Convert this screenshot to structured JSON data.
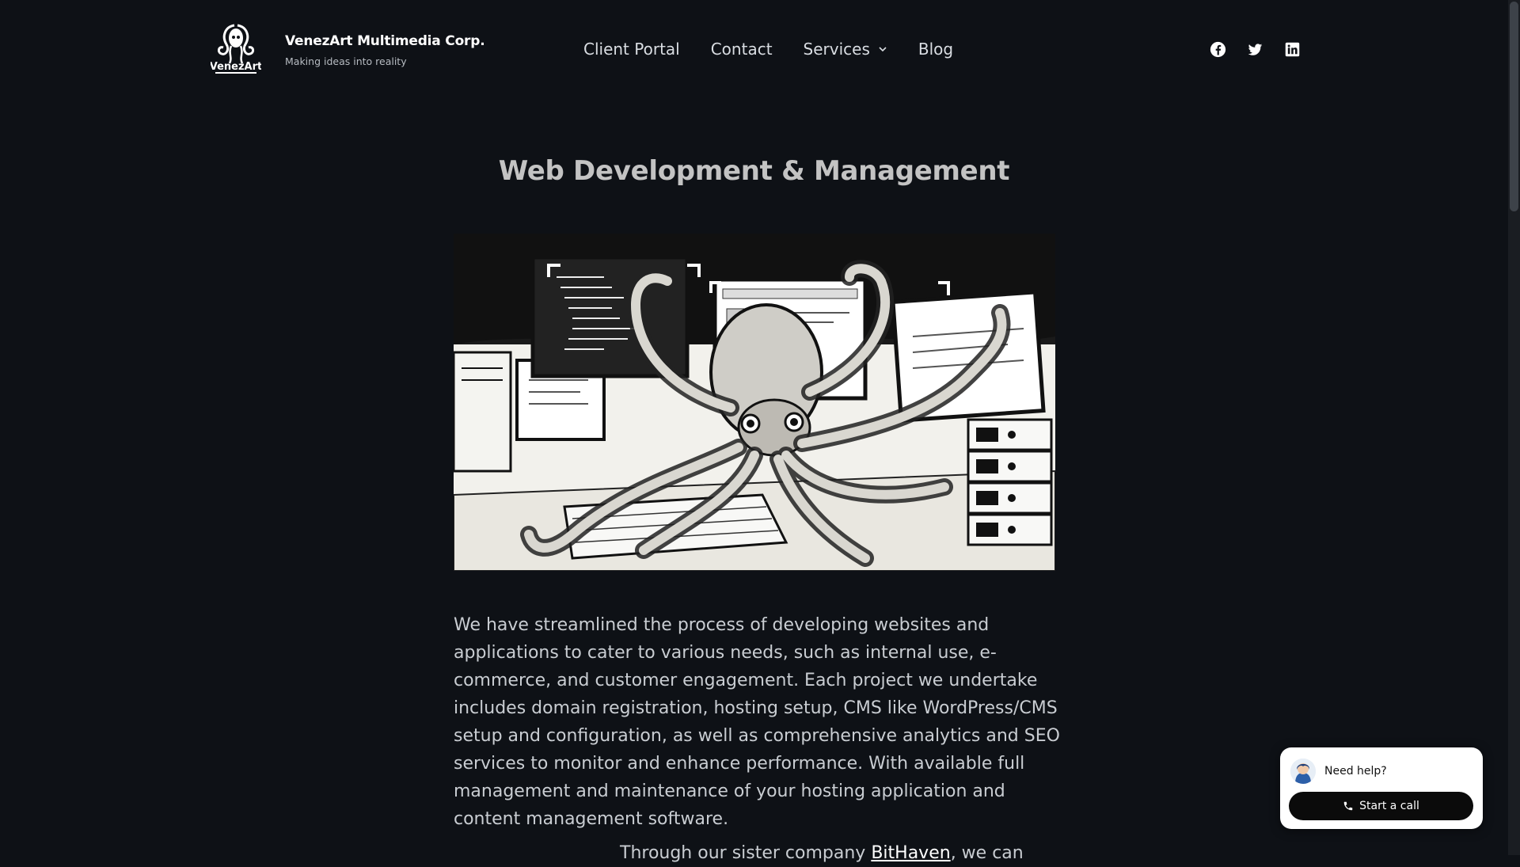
{
  "header": {
    "brand_name": "VenezArt Multimedia Corp.",
    "brand_tagline": "Making ideas into reality",
    "logo_text": "VenezArt",
    "nav": [
      {
        "label": "Client Portal"
      },
      {
        "label": "Contact"
      },
      {
        "label": "Services",
        "has_dropdown": true
      },
      {
        "label": "Blog"
      }
    ],
    "social": [
      "facebook-icon",
      "twitter-icon",
      "linkedin-icon"
    ]
  },
  "main": {
    "title": "Web Development & Management",
    "paragraph": "We have streamlined the process of developing websites and applications to cater to various needs, such as internal use, e-commerce, and customer engagement. Each project we undertake includes domain registration, hosting setup, CMS like WordPress/CMS setup and configuration, as well as comprehensive analytics and SEO services to monitor and enhance performance. With available full management and maintenance of your hosting application and content management software.",
    "paragraph2_before": "Through our sister company ",
    "paragraph2_link": "BitHaven",
    "paragraph2_after": ", we can"
  },
  "chat_widget": {
    "prompt": "Need help?",
    "button_label": "Start a call"
  },
  "colors": {
    "background": "#0e1116",
    "text": "#c9cdd2",
    "title": "#c3c3c3",
    "chat_bg": "#ffffff",
    "chat_button": "#0b0b0b"
  }
}
